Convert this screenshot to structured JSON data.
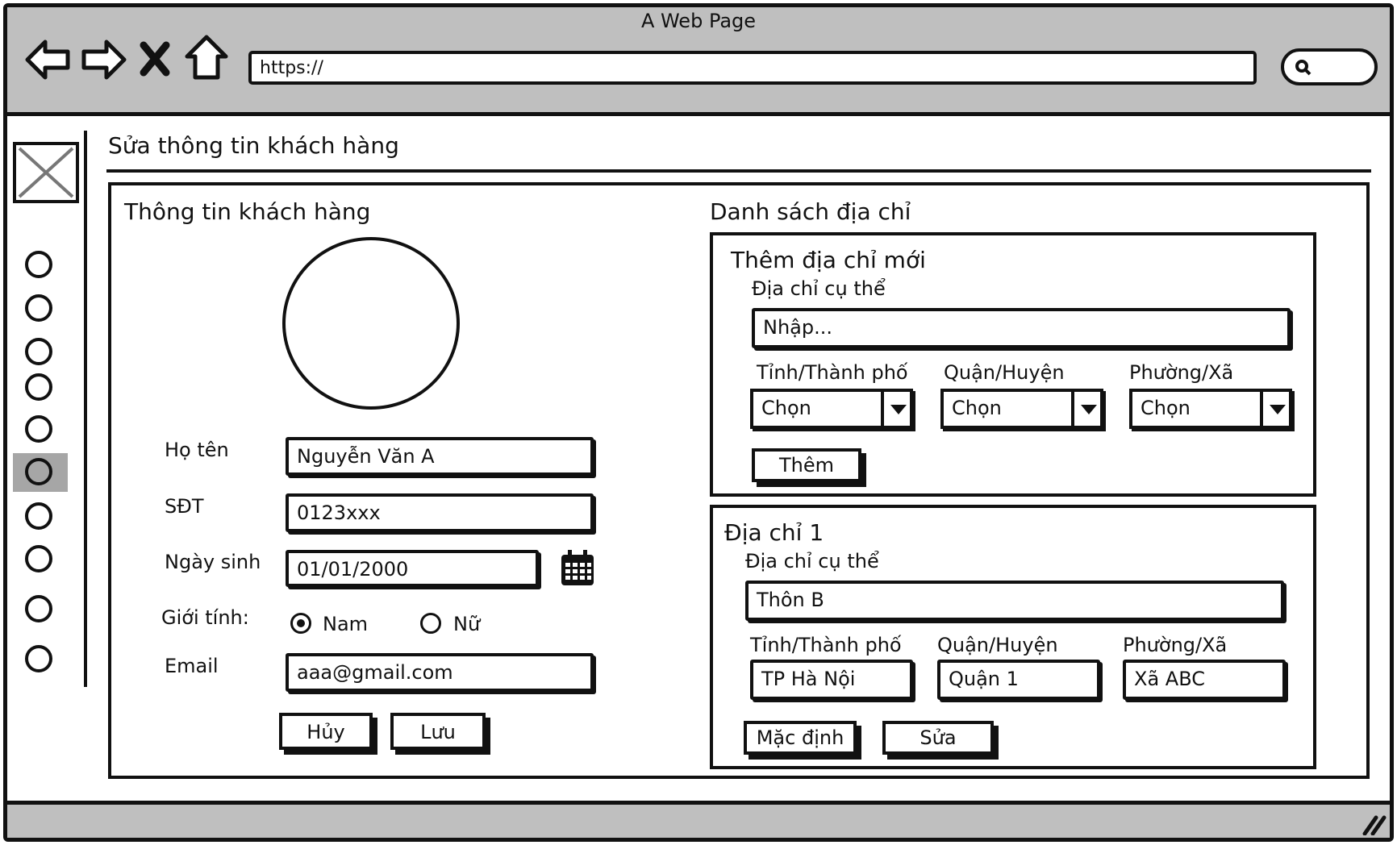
{
  "window": {
    "title": "A Web Page"
  },
  "browser": {
    "url": "https://",
    "nav_icons": [
      "back-icon",
      "forward-icon",
      "close-icon",
      "home-icon"
    ],
    "search_icon": "search-icon"
  },
  "page": {
    "title": "Sửa thông tin khách hàng"
  },
  "sidebar": {
    "item_count": 10,
    "selected_index": 5
  },
  "customer": {
    "section_title": "Thông tin khách hàng",
    "name_label": "Họ tên",
    "name_value": "Nguyễn Văn A",
    "phone_label": "SĐT",
    "phone_value": "0123xxx",
    "dob_label": "Ngày sinh",
    "dob_value": "01/01/2000",
    "gender_label": "Giới tính:",
    "gender_male": "Nam",
    "gender_female": "Nữ",
    "gender_selected": "Nam",
    "email_label": "Email",
    "email_value": "aaa@gmail.com",
    "cancel_label": "Hủy",
    "save_label": "Lưu"
  },
  "addresses": {
    "section_title": "Danh sách địa chỉ",
    "new_address": {
      "title": "Thêm địa chỉ mới",
      "detail_label": "Địa chỉ cụ thể",
      "detail_placeholder": "Nhập...",
      "province_label": "Tỉnh/Thành phố",
      "province_value": "Chọn",
      "district_label": "Quận/Huyện",
      "district_value": "Chọn",
      "ward_label": "Phường/Xã",
      "ward_value": "Chọn",
      "add_label": "Thêm"
    },
    "address_1": {
      "title": "Địa chỉ 1",
      "detail_label": "Địa chỉ cụ thể",
      "detail_value": "Thôn B",
      "province_label": "Tỉnh/Thành phố",
      "province_value": "TP Hà Nội",
      "district_label": "Quận/Huyện",
      "district_value": "Quận 1",
      "ward_label": "Phường/Xã",
      "ward_value": "Xã ABC",
      "default_label": "Mặc định",
      "edit_label": "Sửa"
    }
  }
}
